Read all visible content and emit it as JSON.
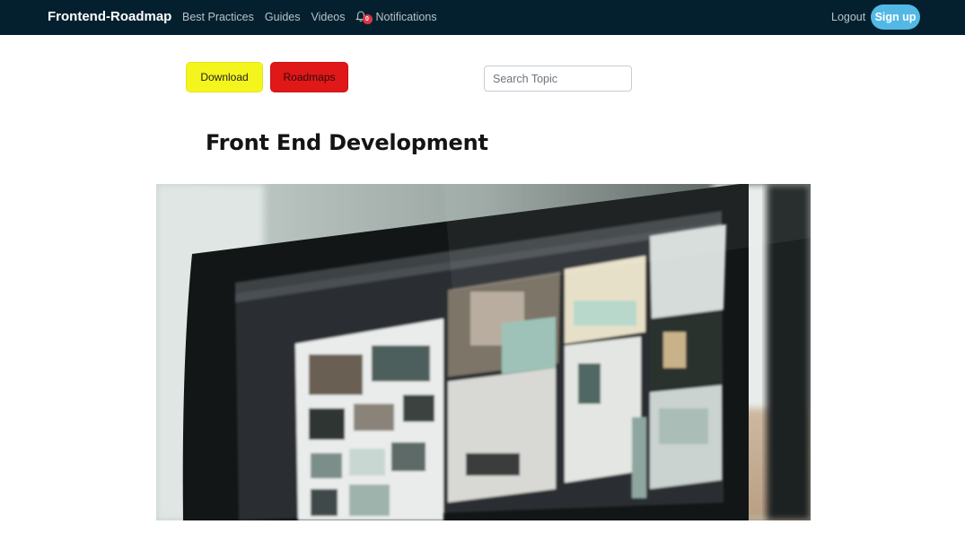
{
  "navbar": {
    "brand": "Frontend-Roadmap",
    "links": [
      "Best Practices",
      "Guides",
      "Videos"
    ],
    "notifications": {
      "label": "Notifications",
      "count": "0",
      "icon": "bell-icon"
    },
    "logout": "Logout",
    "signup": "Sign up",
    "background": "#04202e"
  },
  "actions": {
    "download": "Download",
    "roadmaps": "Roadmaps",
    "download_color": "#f5f51e",
    "roadmaps_color": "#e11818"
  },
  "search": {
    "placeholder": "Search Topic",
    "value": ""
  },
  "page": {
    "title": "Front End Development"
  },
  "hero": {
    "alt": "computer-monitor-photo"
  }
}
